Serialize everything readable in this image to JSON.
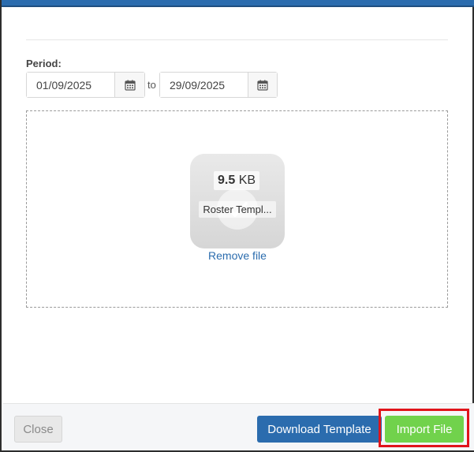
{
  "period": {
    "label": "Period:",
    "from_value": "01/09/2025",
    "to_label": "to",
    "to_value": "29/09/2025",
    "calendar_icon": "calendar-icon"
  },
  "upload": {
    "size_number": "9.5",
    "size_unit": "KB",
    "file_name": "Roster Templ...",
    "remove_label": "Remove file",
    "success_icon": "check-icon"
  },
  "footer": {
    "close_label": "Close",
    "download_label": "Download Template",
    "import_label": "Import File"
  },
  "colors": {
    "primary": "#2b6cae",
    "success": "#71d24c",
    "highlight": "#e0141b"
  }
}
